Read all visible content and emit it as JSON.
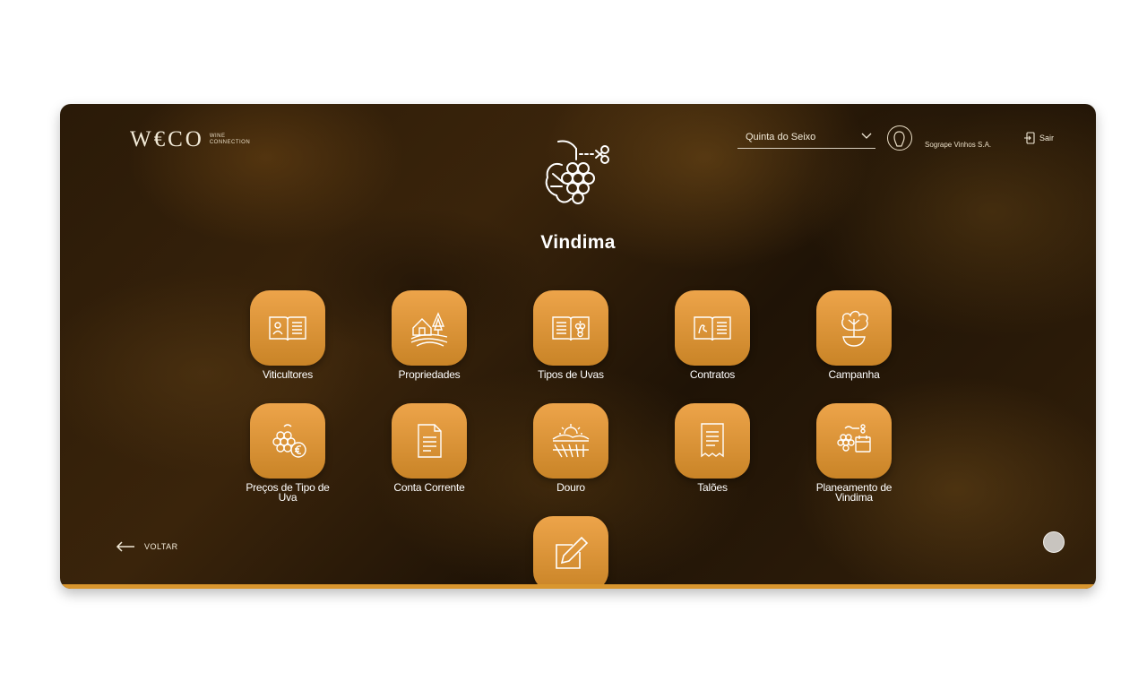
{
  "header": {
    "logo_mark": "W€CO",
    "logo_sub_line1": "WINE",
    "logo_sub_line2": "CONNECTION",
    "farm_select_value": "Quinta do Seixo",
    "company": "Sogrape Vinhos S.A.",
    "logout_label": "Sair"
  },
  "page": {
    "title": "Vindima",
    "hero_icon": "grape-harvest-icon"
  },
  "tiles": [
    {
      "label": "Viticultores",
      "icon": "grower-book-icon"
    },
    {
      "label": "Propriedades",
      "icon": "estate-icon"
    },
    {
      "label": "Tipos de Uvas",
      "icon": "grape-book-icon"
    },
    {
      "label": "Contratos",
      "icon": "contract-book-icon"
    },
    {
      "label": "Campanha",
      "icon": "vine-pot-icon"
    },
    {
      "label": "Preços de Tipo de Uva",
      "icon": "grape-price-icon"
    },
    {
      "label": "Conta Corrente",
      "icon": "document-icon"
    },
    {
      "label": "Douro",
      "icon": "landscape-icon"
    },
    {
      "label": "Talões",
      "icon": "receipt-icon"
    },
    {
      "label": "Planeamento de Vindima",
      "icon": "harvest-planning-icon"
    },
    {
      "label": "",
      "icon": "edit-icon"
    }
  ],
  "footer": {
    "back_label": "VOLTAR"
  },
  "colors": {
    "accent": "#d9962e",
    "tile_top": "#eda44a",
    "tile_bottom": "#c98427"
  }
}
